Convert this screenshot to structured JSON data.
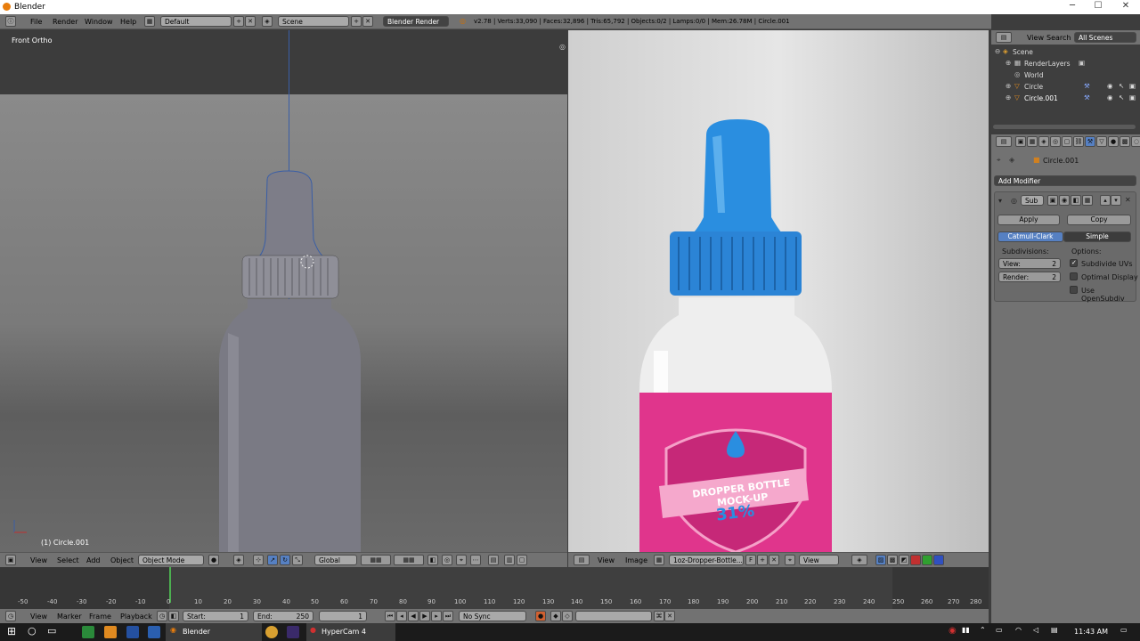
{
  "window": {
    "title": "Blender",
    "min": "─",
    "max": "☐",
    "close": "✕"
  },
  "menu": [
    "File",
    "Render",
    "Window",
    "Help"
  ],
  "layout": "Default",
  "scene": "Scene",
  "engine": "Blender Render",
  "stats": "v2.78 | Verts:33,090 | Faces:32,896 | Tris:65,792 | Objects:0/2 | Lamps:0/0 | Mem:26.78M | Circle.001",
  "viewport": {
    "view_name": "Front Ortho",
    "object_label": "(1) Circle.001",
    "menu": [
      "View",
      "Select",
      "Add",
      "Object"
    ],
    "mode": "Object Mode",
    "orientation": "Global"
  },
  "image_editor": {
    "menu": [
      "View",
      "Image"
    ],
    "image_name": "1oz-Dropper-Bottle...",
    "view": "View"
  },
  "render_label": {
    "line1": "DROPPER BOTTLE MOCK-UP",
    "line2": "31%"
  },
  "timeline": {
    "ticks": [
      "-50",
      "-40",
      "-30",
      "-20",
      "-10",
      "0",
      "10",
      "20",
      "30",
      "40",
      "50",
      "60",
      "70",
      "80",
      "90",
      "100",
      "110",
      "120",
      "130",
      "140",
      "150",
      "160",
      "170",
      "180",
      "190",
      "200",
      "210",
      "220",
      "230",
      "240",
      "250",
      "260",
      "270",
      "280"
    ],
    "menu": [
      "View",
      "Marker",
      "Frame",
      "Playback"
    ],
    "start": "Start:",
    "start_val": "1",
    "end": "End:",
    "end_val": "250",
    "current": "1",
    "sync": "No Sync"
  },
  "outliner": {
    "tabs": [
      "View",
      "Search",
      "All Scenes"
    ],
    "items": [
      "Scene",
      "RenderLayers",
      "World",
      "Circle",
      "Circle.001"
    ]
  },
  "properties": {
    "object": "Circle.001",
    "add_modifier": "Add Modifier",
    "mod_name": "Sub",
    "apply": "Apply",
    "copy": "Copy",
    "catmull": "Catmull-Clark",
    "simple": "Simple",
    "subdivisions": "Subdivisions:",
    "options": "Options:",
    "view": "View:",
    "view_val": "2",
    "render": "Render:",
    "render_val": "2",
    "opt1": "Subdivide UVs",
    "opt2": "Optimal Display",
    "opt3": "Use OpenSubdiv"
  },
  "taskbar": {
    "blender": "Blender",
    "hypercam": "HyperCam 4",
    "time": "11:43 AM"
  }
}
